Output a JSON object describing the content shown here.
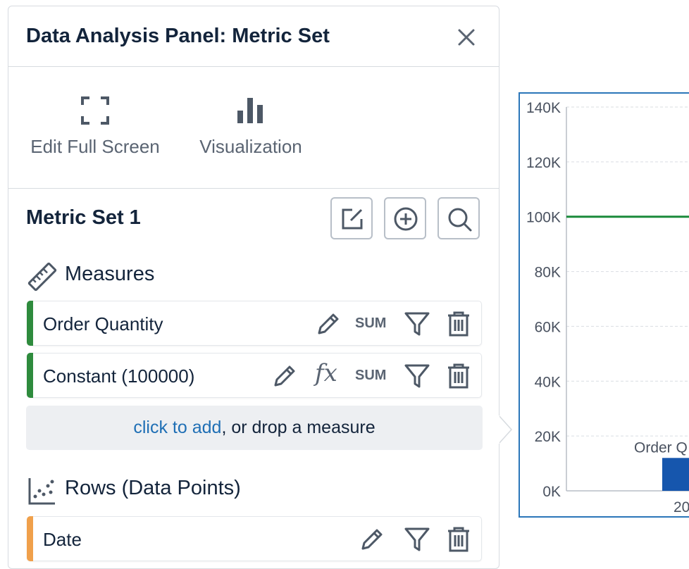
{
  "panel": {
    "title": "Data Analysis Panel: Metric Set"
  },
  "toolbar": {
    "edit_full_screen": "Edit Full Screen",
    "visualization": "Visualization"
  },
  "metric_set": {
    "title": "Metric Set 1"
  },
  "measures": {
    "heading": "Measures",
    "items": [
      {
        "name": "Order Quantity",
        "agg": "SUM"
      },
      {
        "name": "Constant (100000)",
        "agg": "SUM"
      }
    ],
    "drop_link": "click to add",
    "drop_text": ", or drop a measure"
  },
  "rows": {
    "heading": "Rows (Data Points)",
    "items": [
      {
        "name": "Date"
      }
    ]
  },
  "colors": {
    "measure_bar": "#2e8b3d",
    "row_bar": "#f0a04b",
    "chart_border": "#2b76b9",
    "line": "#1a8a3a",
    "bar": "#1656ad"
  },
  "chart_data": {
    "type": "bar",
    "y_ticks": [
      "140K",
      "120K",
      "100K",
      "80K",
      "60K",
      "40K",
      "20K",
      "0K"
    ],
    "ylim": [
      0,
      140000
    ],
    "grid": true,
    "series": [
      {
        "name": "Order Q",
        "type": "bar",
        "values": [
          12000
        ]
      },
      {
        "type": "line",
        "values": [
          100000
        ]
      }
    ],
    "categories": [
      "20"
    ]
  }
}
